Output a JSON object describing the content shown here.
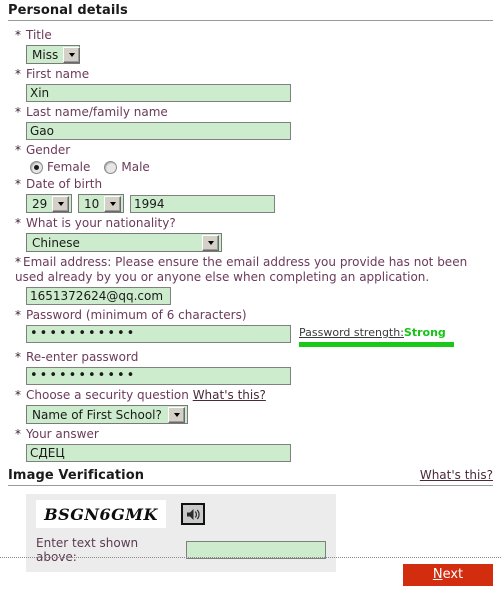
{
  "sections": {
    "personal": {
      "heading": "Personal details"
    },
    "image_verification": {
      "heading": "Image Verification",
      "whats_this": "What's this?",
      "captcha_text": "BSGN6GMK",
      "audio_icon": "speaker-icon",
      "entry_label": "Enter text shown above:",
      "entry_value": ""
    }
  },
  "fields": {
    "title": {
      "label": "Title",
      "required_marker": "*",
      "value": "Miss"
    },
    "first_name": {
      "label": "First name",
      "required_marker": "*",
      "value": "Xin"
    },
    "last_name": {
      "label": "Last name/family name",
      "required_marker": "*",
      "value": "Gao"
    },
    "gender": {
      "label": "Gender",
      "required_marker": "*",
      "option_female": "Female",
      "option_male": "Male",
      "selected": "Female"
    },
    "dob": {
      "label": "Date of birth",
      "required_marker": "*",
      "day": "29",
      "month": "10",
      "year": "1994"
    },
    "nationality": {
      "label": "What is your nationality?",
      "required_marker": "*",
      "value": "Chinese"
    },
    "email": {
      "label": "Email address: Please ensure the email address you provide has not been used already by you or anyone else when completing an application.",
      "required_marker": "*",
      "value": "1651372624@qq.com"
    },
    "password": {
      "label": "Password (minimum of 6 characters)",
      "required_marker": "*",
      "value": "•••••••••••",
      "strength_label": "Password strength:",
      "strength_value": "Strong",
      "strength_color": "#14c414"
    },
    "password_confirm": {
      "label": "Re-enter password",
      "required_marker": "*",
      "value": "•••••••••••"
    },
    "security_question": {
      "label": "Choose a security question",
      "required_marker": "*",
      "whats_this": "What's this?",
      "value": "Name of First School?"
    },
    "security_answer": {
      "label": "Your answer",
      "required_marker": "*",
      "value": "СДЕЦ"
    }
  },
  "footer": {
    "next_label_prefix": "N",
    "next_label_rest": "ext",
    "next_full": "Next",
    "button_color": "#d32d10"
  }
}
